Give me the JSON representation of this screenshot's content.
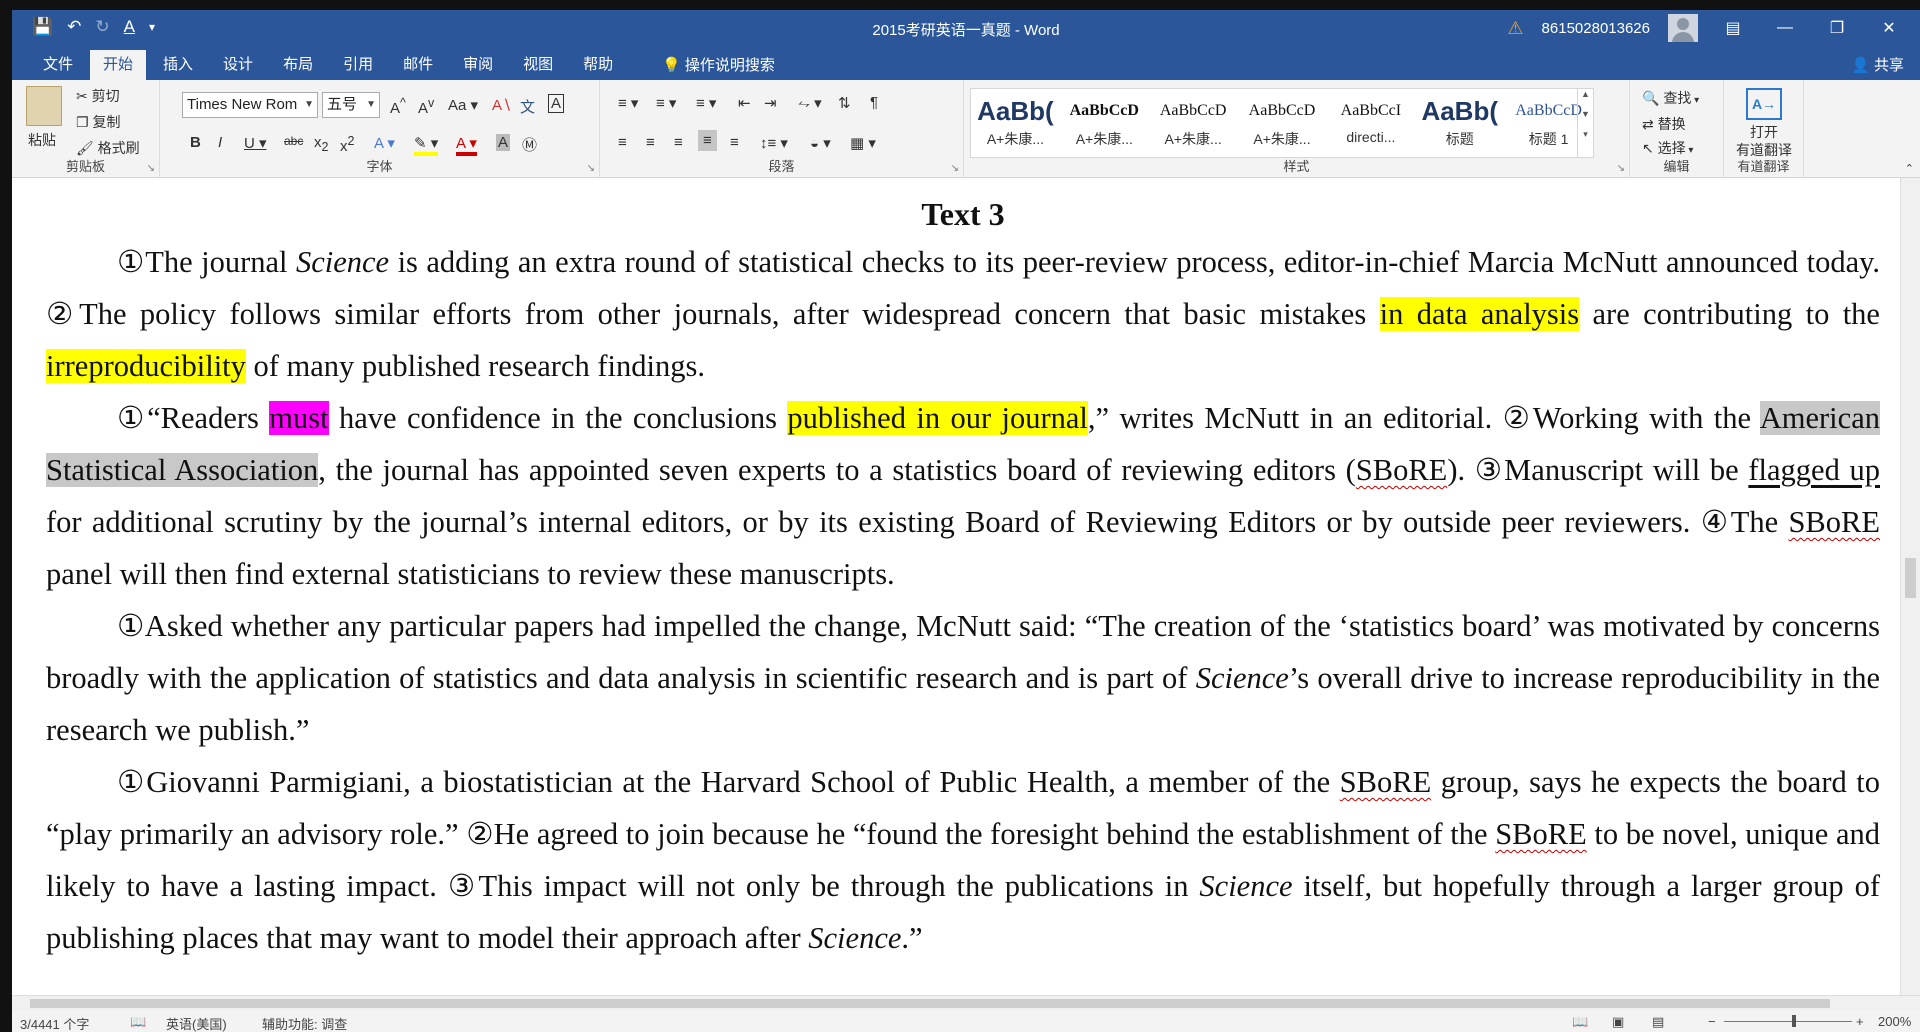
{
  "titlebar": {
    "title": "2015考研英语一真题  -  Word",
    "user": "8615028013626",
    "qat": [
      "save-icon",
      "undo-icon",
      "redo-icon",
      "font-color-icon",
      "customize-icon"
    ]
  },
  "tabs": [
    "文件",
    "开始",
    "插入",
    "设计",
    "布局",
    "引用",
    "邮件",
    "审阅",
    "视图",
    "帮助"
  ],
  "active_tab": "开始",
  "tellme": "操作说明搜索",
  "share": "共享",
  "ribbon": {
    "clipboard": {
      "label": "剪贴板",
      "paste": "粘贴",
      "cut": "剪切",
      "copy": "复制",
      "format_painter": "格式刷"
    },
    "font": {
      "label": "字体",
      "font_name": "Times New Rom",
      "font_size": "五号"
    },
    "paragraph": {
      "label": "段落"
    },
    "styles": {
      "label": "样式",
      "items": [
        {
          "sample": "AaBb(",
          "name": "A+朱康..."
        },
        {
          "sample": "AaBbCcD",
          "name": "A+朱康..."
        },
        {
          "sample": "AaBbCcD",
          "name": "A+朱康..."
        },
        {
          "sample": "AaBbCcD",
          "name": "A+朱康..."
        },
        {
          "sample": "AaBbCcI",
          "name": "directi..."
        },
        {
          "sample": "AaBb(",
          "name": "标题"
        },
        {
          "sample": "AaBbCcD",
          "name": "标题 1"
        }
      ]
    },
    "editing": {
      "label": "编辑",
      "find": "查找",
      "replace": "替换",
      "select": "选择"
    },
    "youdao": {
      "label": "有道翻译",
      "open": "打开",
      "name": "有道翻译"
    }
  },
  "document": {
    "heading": "Text 3",
    "p1": {
      "a": "①The journal ",
      "b": "Science",
      "c": " is adding an extra round of statistical checks to its peer-review process, editor-in-chief Marcia McNutt announced today. ②The policy follows similar efforts from other journals, after widespread concern that basic mistakes ",
      "d": "in data analysis",
      "e": " are contributing to the ",
      "f": "irreproducibility",
      "g": " of many published research findings."
    },
    "p2": {
      "a": "①“Readers ",
      "b": "must",
      "c": " have confidence in the conclusions ",
      "d": "published in our journal",
      "e": ",” writes McNutt in an editorial. ②Working with the ",
      "f": "American Statistical Association",
      "g": ", the journal has appointed seven experts to a statistics board of reviewing editors (",
      "h": "SBoRE",
      "i": "). ③Manuscript will be ",
      "j": "flagged up",
      "k": " for additional scrutiny by the journal’s internal editors, or by its existing Board of Reviewing Editors or by outside peer reviewers. ④The ",
      "l": "SBoRE",
      "m": " panel will then find external statisticians to review these manuscripts."
    },
    "p3": {
      "a": "①Asked whether any particular papers had impelled the change, McNutt said: “The creation of the ‘statistics board’ was motivated by concerns broadly with the application of statistics and data analysis in scientific research and is part of ",
      "b": "Science",
      "c": "’s overall drive to increase reproducibility in the research we publish.”"
    },
    "p4": {
      "a": "①Giovanni Parmigiani, a biostatistician at the Harvard School of Public Health, a member of the ",
      "b": "SBoRE",
      "c": " group, says he expects the board to “play primarily an advisory role.” ②He agreed to join because he “found the foresight behind the establishment of the ",
      "d": "SBoRE",
      "e": " to be novel, unique and likely to have a lasting impact. ③This impact will not only be through the publications in ",
      "f": "Science",
      "g": " itself, but hopefully through a larger group of publishing places that may want to model their approach after ",
      "h": "Science",
      "i": ".”"
    }
  },
  "status": {
    "words": "3/4441 个字",
    "language": "英语(美国)",
    "accessibility": "辅助功能: 调查",
    "zoom": "200%"
  }
}
